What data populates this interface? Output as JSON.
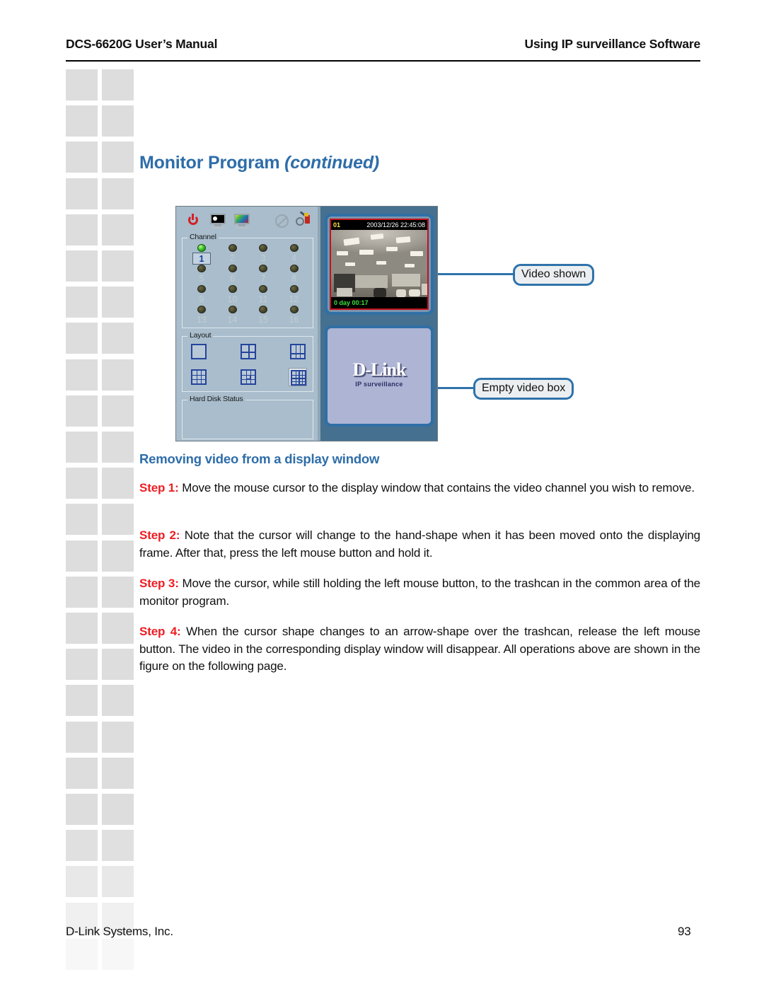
{
  "header": {
    "left": "DCS-6620G User’s Manual",
    "right": "Using IP surveillance Software"
  },
  "title": {
    "main": "Monitor Program ",
    "continued": "(continued)"
  },
  "figure": {
    "toolbar": [
      {
        "name": "power-icon",
        "label": "Power"
      },
      {
        "name": "monochrome-monitor-icon",
        "label": "Monochrome view"
      },
      {
        "name": "color-monitor-icon",
        "label": "Color view"
      },
      {
        "name": "disabled-record-icon",
        "label": "Disabled"
      },
      {
        "name": "tools-icon",
        "label": "Tools"
      }
    ],
    "channel_group": {
      "title": "Channel",
      "channels": [
        {
          "num": "1",
          "active": true
        },
        {
          "num": "2",
          "active": false
        },
        {
          "num": "3",
          "active": false
        },
        {
          "num": "4",
          "active": false
        },
        {
          "num": "5",
          "active": false
        },
        {
          "num": "6",
          "active": false
        },
        {
          "num": "7",
          "active": false
        },
        {
          "num": "8",
          "active": false
        },
        {
          "num": "9",
          "active": false
        },
        {
          "num": "10",
          "active": false
        },
        {
          "num": "11",
          "active": false
        },
        {
          "num": "12",
          "active": false
        },
        {
          "num": "13",
          "active": false
        },
        {
          "num": "14",
          "active": false
        },
        {
          "num": "15",
          "active": false
        },
        {
          "num": "16",
          "active": false
        }
      ]
    },
    "layout_group": {
      "title": "Layout",
      "buttons": [
        {
          "name": "layout-1",
          "selected": false
        },
        {
          "name": "layout-4",
          "selected": false
        },
        {
          "name": "layout-1plus3",
          "selected": false
        },
        {
          "name": "layout-9",
          "selected": false
        },
        {
          "name": "layout-6",
          "selected": false
        },
        {
          "name": "layout-16",
          "selected": true
        }
      ]
    },
    "hdd_group": {
      "title": "Hard Disk Status"
    },
    "video_box_1": {
      "channel": "01",
      "timestamp": "2003/12/26 22:45:08",
      "elapsed": "0 day 00:17"
    },
    "video_box_2": {
      "logo_name": "D-Link",
      "logo_sub": "IP surveillance"
    },
    "callouts": [
      {
        "name": "callout-video-shown",
        "text": "Video shown"
      },
      {
        "name": "callout-empty-video-box",
        "text": "Empty video box"
      }
    ]
  },
  "subsection": {
    "title": "Removing video from a display window"
  },
  "steps": [
    {
      "label": "Step 1:",
      "text": " Move the mouse cursor to the display window that contains the video channel you wish to remove."
    },
    {
      "label": "Step 2:",
      "text": " Note that the cursor will change to the hand-shape when it has been moved onto the displaying frame. After that, press the left mouse button and hold it."
    },
    {
      "label": "Step 3:",
      "text": " Move the cursor, while still holding the left mouse button, to the trashcan in the common area of the monitor program."
    },
    {
      "label": "Step 4:",
      "text": " When the cursor shape changes to an arrow-shape over the trashcan, release the left mouse button. The video in the corresponding display window will disappear. All operations above are shown in the figure on the following page."
    }
  ],
  "footer": {
    "company": "D-Link Systems, Inc.",
    "page": "93"
  },
  "colors": {
    "accent_blue": "#2e6da9",
    "step_red": "#ee1d23",
    "panel_bg": "#a9bdcc",
    "video_pane_bg": "#46708f",
    "callout_border": "#2f73ab",
    "deco_square": "#dddddd"
  }
}
